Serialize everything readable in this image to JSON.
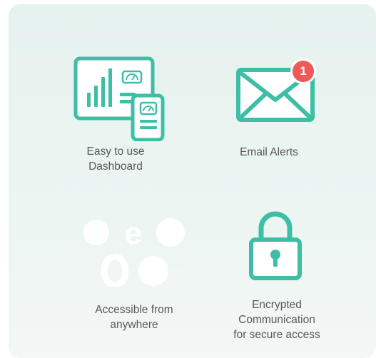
{
  "features": [
    {
      "caption": "Easy to use\nDashboard",
      "icon": "dashboard-icon"
    },
    {
      "caption": "Email Alerts",
      "icon": "email-icon",
      "badge_count": "1"
    },
    {
      "caption": "Accessible from\nanywhere",
      "icon": "browsers-icon"
    },
    {
      "caption": "Encrypted\nCommunication\nfor secure access",
      "icon": "padlock-icon"
    }
  ],
  "colors": {
    "accent": "#3dbfa5",
    "badge": "#ee5a55",
    "caption": "#585858",
    "card_bg": "#e8f3f0"
  }
}
